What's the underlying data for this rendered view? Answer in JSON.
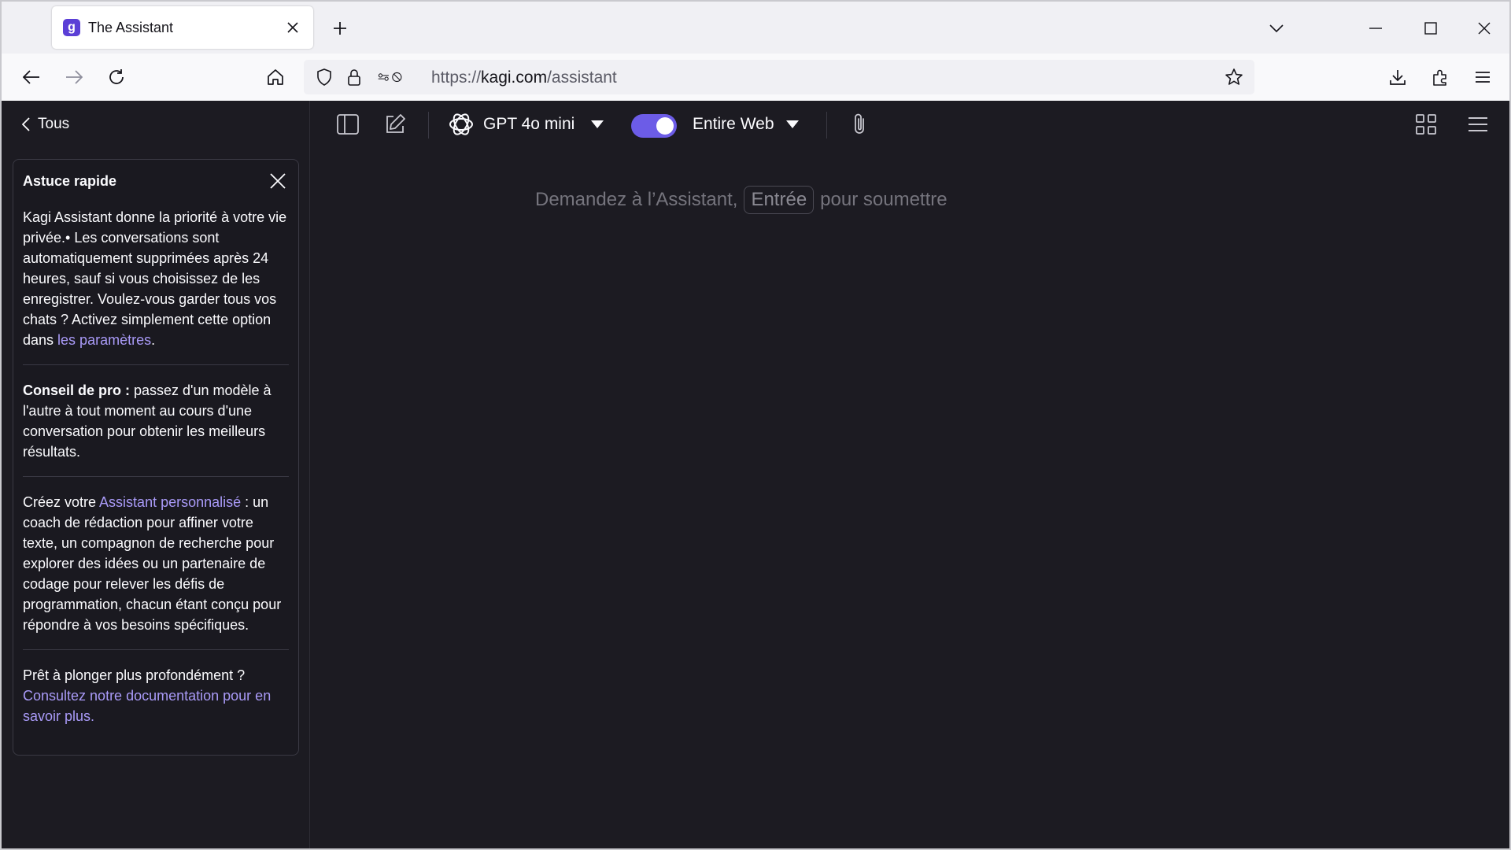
{
  "browser": {
    "tab": {
      "title": "The Assistant",
      "favicon_letter": "g"
    },
    "url": {
      "prefix": "https://",
      "domain": "kagi.com",
      "path": "/assistant"
    },
    "icons": {
      "back": "arrow-left-icon",
      "forward": "arrow-right-icon",
      "reload": "reload-icon",
      "home": "home-icon",
      "shield": "shield-icon",
      "lock": "lock-icon",
      "permissions": "permissions-icon",
      "bookmark": "star-icon",
      "downloads": "download-icon",
      "extensions": "puzzle-icon",
      "menu": "hamburger-icon"
    }
  },
  "toolbar": {
    "back_label": "Tous",
    "model_name": "GPT 4o mini",
    "web_toggle_on": true,
    "web_scope": "Entire Web"
  },
  "sidebar": {
    "tip": {
      "title": "Astuce rapide",
      "p1_text": "Kagi Assistant donne la priorité à votre vie privée.• Les conversations sont automatiquement supprimées après 24 heures, sauf si vous choisissez de les enregistrer. Voulez-vous garder tous vos chats ? Activez simplement cette option dans ",
      "p1_link": "les paramètres",
      "p1_end": ".",
      "p2_bold": "Conseil de pro :",
      "p2_text": " passez d'un modèle à l'autre à tout moment au cours d'une conversation pour obtenir les meilleurs résultats.",
      "p3_start": "Créez votre ",
      "p3_link": "Assistant personnalisé",
      "p3_text": " : un coach de rédaction pour affiner votre texte, un compagnon de recherche pour explorer des idées ou un partenaire de codage pour relever les défis de programmation, chacun étant conçu pour répondre à vos besoins spécifiques.",
      "p4_text": "Prêt à plonger plus profondément ?",
      "p4_link": "Consultez notre documentation pour en savoir plus."
    }
  },
  "main": {
    "prompt_before": "Demandez à l’Assistant,",
    "prompt_key": "Entrée",
    "prompt_after": "pour soumettre"
  },
  "colors": {
    "accent": "#6c5ce7",
    "link": "#a99af7",
    "background": "#1c1b22"
  }
}
